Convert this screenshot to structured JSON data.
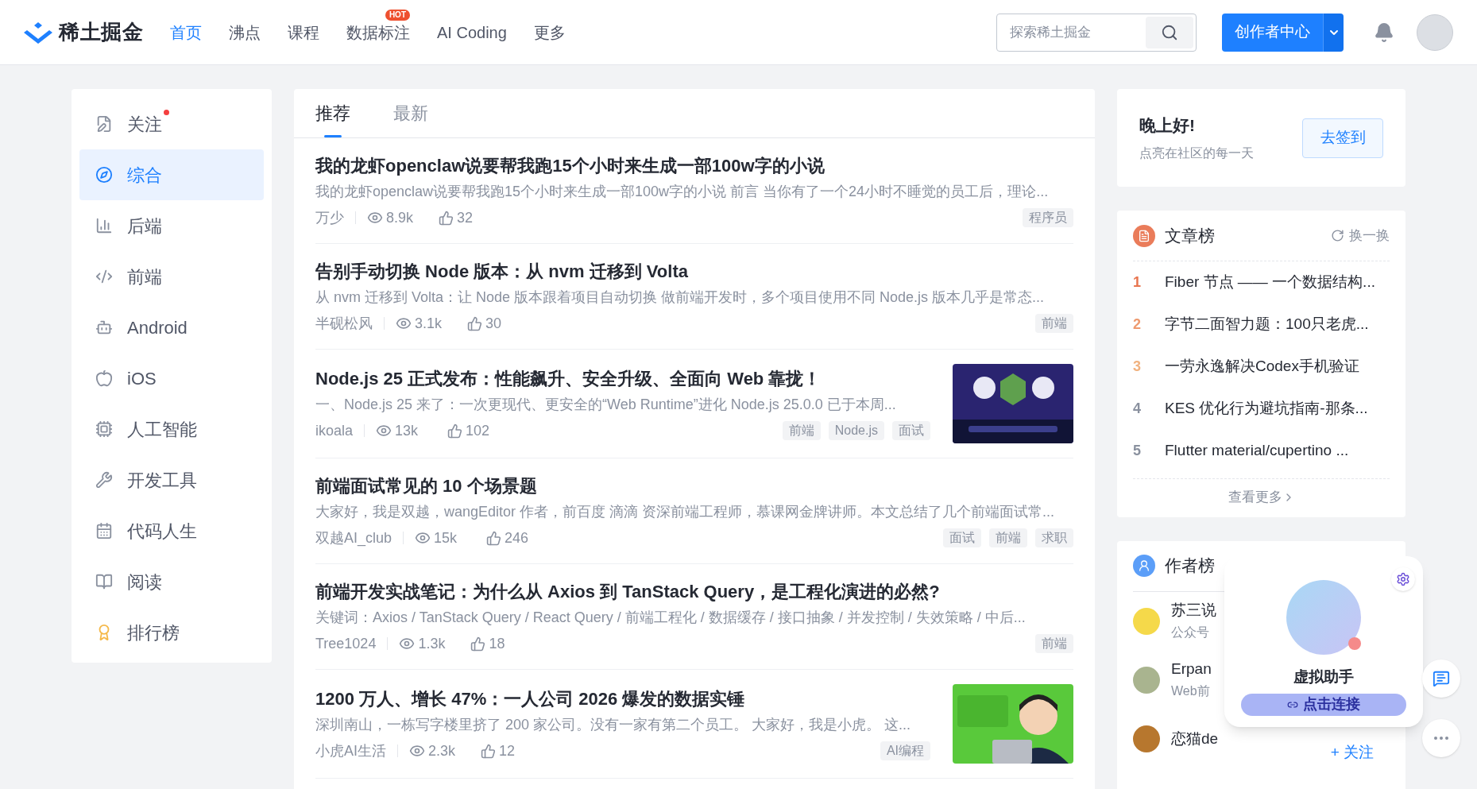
{
  "header": {
    "logo": "稀土掘金",
    "nav": [
      {
        "label": "首页",
        "selected": true
      },
      {
        "label": "沸点",
        "selected": false
      },
      {
        "label": "课程",
        "selected": false
      },
      {
        "label": "数据标注",
        "selected": false,
        "badge": "HOT"
      },
      {
        "label": "AI Coding",
        "selected": false
      },
      {
        "label": "更多",
        "selected": false
      }
    ],
    "search": {
      "placeholder": "探索稀土掘金"
    },
    "creator_button": "创作者中心"
  },
  "sidebar": {
    "items": [
      {
        "label": "关注",
        "selected": false,
        "dot": true
      },
      {
        "label": "综合",
        "selected": true,
        "dot": false
      },
      {
        "label": "后端",
        "selected": false,
        "dot": false
      },
      {
        "label": "前端",
        "selected": false,
        "dot": false
      },
      {
        "label": "Android",
        "selected": false,
        "dot": false
      },
      {
        "label": "iOS",
        "selected": false,
        "dot": false
      },
      {
        "label": "人工智能",
        "selected": false,
        "dot": false
      },
      {
        "label": "开发工具",
        "selected": false,
        "dot": false
      },
      {
        "label": "代码人生",
        "selected": false,
        "dot": false
      },
      {
        "label": "阅读",
        "selected": false,
        "dot": false
      },
      {
        "label": "排行榜",
        "selected": false,
        "dot": false
      }
    ]
  },
  "feed": {
    "tabs": [
      {
        "label": "推荐",
        "selected": true
      },
      {
        "label": "最新",
        "selected": false
      }
    ],
    "articles": [
      {
        "title": "我的龙虾openclaw说要帮我跑15个小时来生成一部100w字的小说",
        "abstract": "我的龙虾openclaw说要帮我跑15个小时来生成一部100w字的小说 前言 当你有了一个24小时不睡觉的员工后，理论...",
        "author": "万少",
        "views": "8.9k",
        "likes": "32",
        "tags": [
          "程序员"
        ]
      },
      {
        "title": "告别手动切换 Node 版本：从 nvm 迁移到 Volta",
        "abstract": "从 nvm 迁移到 Volta：让 Node 版本跟着项目自动切换 做前端开发时，多个项目使用不同 Node.js 版本几乎是常态...",
        "author": "半砚松风",
        "views": "3.1k",
        "likes": "30",
        "tags": [
          "前端"
        ]
      },
      {
        "title": "Node.js 25 正式发布：性能飙升、安全升级、全面向 Web 靠拢！",
        "abstract": "一、Node.js 25 来了：一次更现代、更安全的“Web Runtime”进化 Node.js 25.0.0 已于本周...",
        "author": "ikoala",
        "views": "13k",
        "likes": "102",
        "tags": [
          "前端",
          "Node.js",
          "面试"
        ],
        "thumbnail": {
          "kind": "picture"
        }
      },
      {
        "title": "前端面试常见的 10 个场景题",
        "abstract": "大家好，我是双越，wangEditor 作者，前百度 滴滴 资深前端工程师，慕课网金牌讲师。本文总结了几个前端面试常...",
        "author": "双越AI_club",
        "views": "15k",
        "likes": "246",
        "tags": [
          "面试",
          "前端",
          "求职"
        ]
      },
      {
        "title": "前端开发实战笔记：为什么从 Axios 到 TanStack Query，是工程化演进的必然?",
        "abstract": "关键词：Axios / TanStack Query / React Query / 前端工程化 / 数据缓存 / 接口抽象 / 并发控制 / 失效策略 / 中后...",
        "author": "Tree1024",
        "views": "1.3k",
        "likes": "18",
        "tags": [
          "前端"
        ]
      },
      {
        "title": "1200 万人、增长 47%：一人公司 2026 爆发的数据实锤",
        "abstract": "深圳南山，一栋写字楼里挤了 200 家公司。没有一家有第二个员工。 大家好，我是小虎。 这...",
        "author": "小虎AI生活",
        "views": "2.3k",
        "likes": "12",
        "tags": [
          "AI编程"
        ],
        "thumbnail": {
          "kind": "picture"
        }
      }
    ]
  },
  "greeting": {
    "title": "晚上好!",
    "subtitle": "点亮在社区的每一天",
    "button": "去签到"
  },
  "article_board": {
    "title": "文章榜",
    "refresh": "换一换",
    "more": "查看更多",
    "items": [
      {
        "rank": "1",
        "title": "Fiber 节点 —— 一个数据结构...",
        "color": "#e8754f"
      },
      {
        "rank": "2",
        "title": "字节二面智力题：100只老虎...",
        "color": "#ee9a6f"
      },
      {
        "rank": "3",
        "title": "一劳永逸解决Codex手机验证",
        "color": "#f1b27f"
      },
      {
        "rank": "4",
        "title": "KES 优化行为避坑指南-那条...",
        "color": "#8a919f"
      },
      {
        "rank": "5",
        "title": "Flutter material/cupertino ...",
        "color": "#8a919f"
      }
    ]
  },
  "author_board": {
    "title": "作者榜",
    "authors": [
      {
        "name": "苏三说",
        "description": "公众号"
      },
      {
        "name": "Erpan",
        "description": "Web前"
      },
      {
        "name": "恋猫de",
        "follow": "+ 关注"
      }
    ]
  },
  "assistant": {
    "name": "虚拟助手",
    "button": "点击连接"
  }
}
